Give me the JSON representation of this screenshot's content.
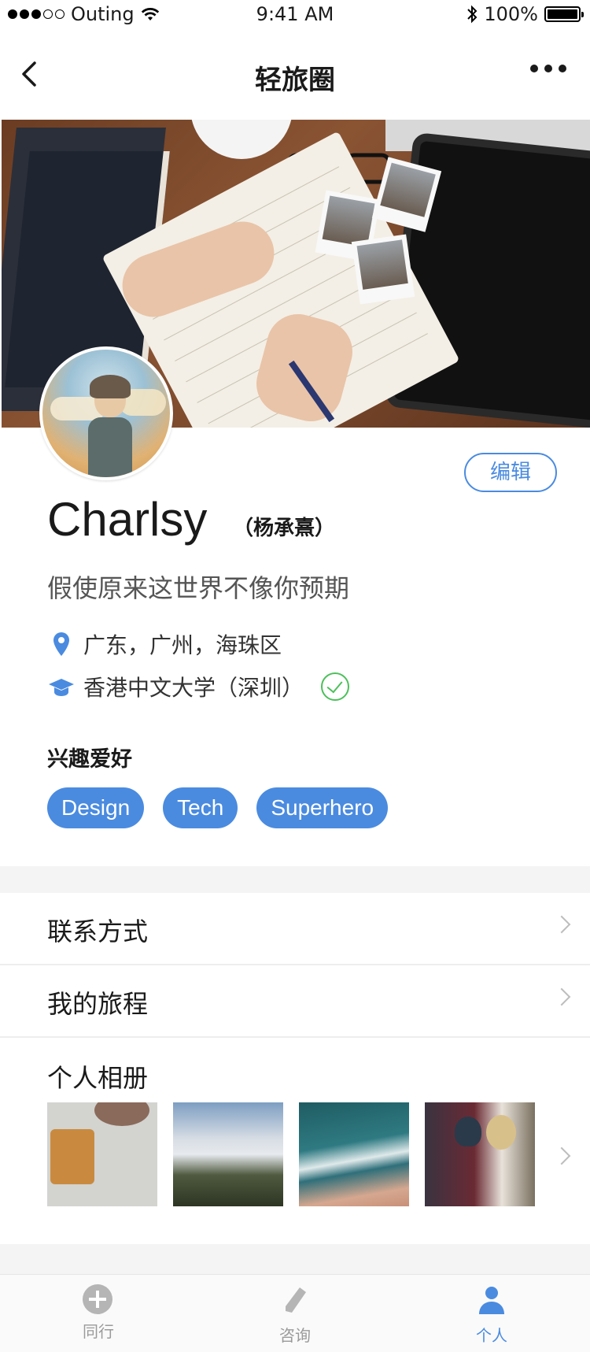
{
  "status_bar": {
    "carrier": "Outing",
    "time": "9:41 AM",
    "battery": "100%"
  },
  "nav": {
    "title": "轻旅圈"
  },
  "profile": {
    "edit_label": "编辑",
    "name": "Charlsy",
    "real_name": "（杨承熹）",
    "bio": "假使原来这世界不像你预期",
    "location": "广东，广州，海珠区",
    "school": "香港中文大学（深圳）",
    "hobbies_title": "兴趣爱好",
    "hobbies": [
      "Design",
      "Tech",
      "Superhero"
    ]
  },
  "menu": {
    "contact": "联系方式",
    "trips": "我的旅程",
    "album": "个人相册"
  },
  "tabbar": {
    "items": [
      {
        "label": "同行",
        "icon": "plus-circle-icon"
      },
      {
        "label": "咨询",
        "icon": "pencil-icon"
      },
      {
        "label": "个人",
        "icon": "person-icon"
      }
    ],
    "active_color": "#4a8be0"
  },
  "colors": {
    "accent": "#4a8be0",
    "verified": "#4cc05a"
  }
}
